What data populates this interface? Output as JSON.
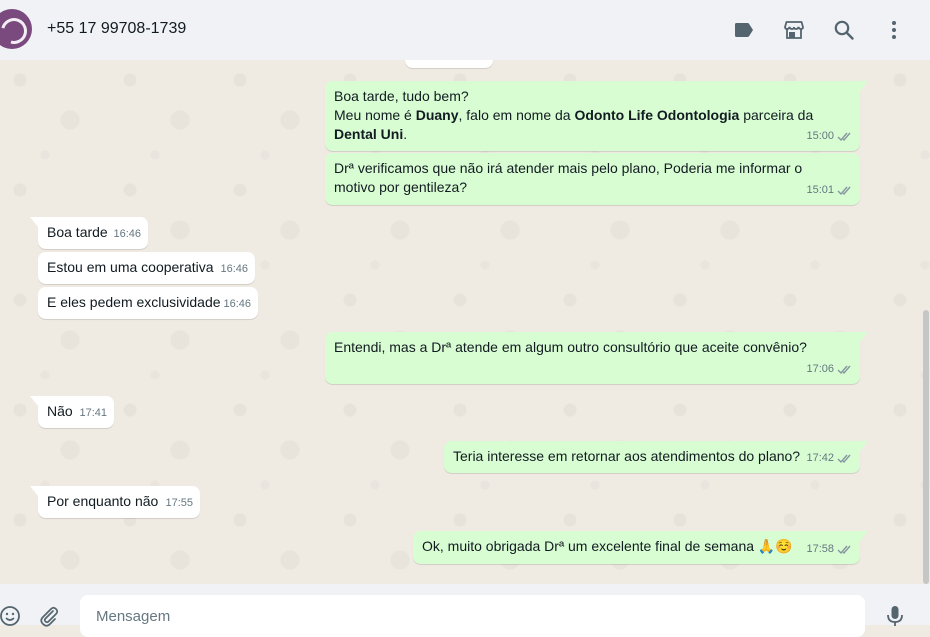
{
  "header": {
    "contact": "+55 17 99708-1739",
    "icons": [
      "label-icon",
      "store-icon",
      "search-icon",
      "menu-icon"
    ]
  },
  "messages": [
    {
      "dir": "out",
      "time": "15:00",
      "status": "read",
      "parts": [
        {
          "t": "Boa tarde, tudo bem?"
        },
        {
          "br": true
        },
        {
          "t": "Meu nome é "
        },
        {
          "t": "Duany",
          "b": true
        },
        {
          "t": ", falo em nome da "
        },
        {
          "t": "Odonto Life Odontologia",
          "b": true
        },
        {
          "t": " parceira da "
        },
        {
          "br": true
        },
        {
          "t": "Dental Uni",
          "b": true
        },
        {
          "t": "."
        }
      ]
    },
    {
      "dir": "out",
      "time": "15:01",
      "status": "read",
      "text": "Drª verificamos que não irá atender mais pelo plano, Poderia me informar o motivo por gentileza?"
    },
    {
      "dir": "in",
      "time": "16:46",
      "text": "Boa tarde"
    },
    {
      "dir": "in",
      "time": "16:46",
      "text": "Estou em uma cooperativa"
    },
    {
      "dir": "in",
      "time": "16:46",
      "text": "E eles pedem exclusividade"
    },
    {
      "dir": "out",
      "time": "17:06",
      "status": "read",
      "text": "Entendi, mas a Drª atende em algum outro consultório que aceite convênio?"
    },
    {
      "dir": "in",
      "time": "17:41",
      "text": "Não"
    },
    {
      "dir": "out",
      "time": "17:42",
      "status": "read",
      "text": "Teria interesse em retornar aos atendimentos do plano?"
    },
    {
      "dir": "in",
      "time": "17:55",
      "text": "Por enquanto não"
    },
    {
      "dir": "out",
      "time": "17:58",
      "status": "read",
      "text": "Ok, muito obrigada Drª um excelente final de semana 🙏☺️"
    }
  ],
  "composer": {
    "placeholder": "Mensagem"
  },
  "colors": {
    "outgoing": "#d9fdd3",
    "incoming": "#ffffff",
    "background": "#efeae2",
    "read_ticks": "#53bdeb",
    "header": "#f0f2f5"
  }
}
